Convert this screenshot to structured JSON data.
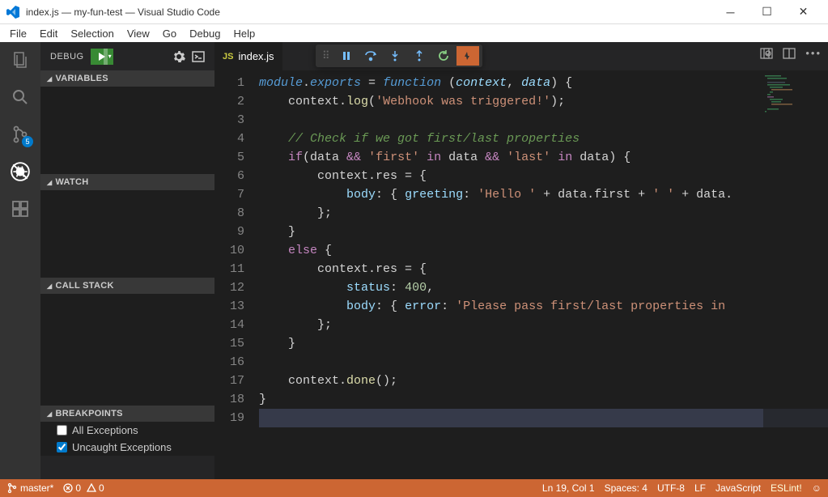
{
  "title": "index.js — my-fun-test — Visual Studio Code",
  "menu": [
    "File",
    "Edit",
    "Selection",
    "View",
    "Go",
    "Debug",
    "Help"
  ],
  "activity_badge": "5",
  "sidebar": {
    "header": "DEBUG",
    "sections": {
      "variables": "VARIABLES",
      "watch": "WATCH",
      "callstack": "CALL STACK",
      "breakpoints": "BREAKPOINTS"
    },
    "breakpoints": [
      {
        "label": "All Exceptions",
        "checked": false
      },
      {
        "label": "Uncaught Exceptions",
        "checked": true
      }
    ]
  },
  "tab": {
    "filename": "index.js",
    "lang_icon": "JS"
  },
  "code_lines": [
    {
      "n": 1,
      "segs": [
        {
          "c": "k1",
          "t": "module"
        },
        {
          "c": "p",
          "t": "."
        },
        {
          "c": "k1",
          "t": "exports"
        },
        {
          "c": "op",
          "t": " = "
        },
        {
          "c": "k1",
          "t": "function"
        },
        {
          "c": "op",
          "t": " ("
        },
        {
          "c": "v",
          "t": "context"
        },
        {
          "c": "op",
          "t": ", "
        },
        {
          "c": "v",
          "t": "data"
        },
        {
          "c": "op",
          "t": ") {"
        }
      ]
    },
    {
      "n": 2,
      "segs": [
        {
          "c": "op",
          "t": "    context."
        },
        {
          "c": "fn",
          "t": "log"
        },
        {
          "c": "op",
          "t": "("
        },
        {
          "c": "s",
          "t": "'Webhook was triggered!'"
        },
        {
          "c": "op",
          "t": ");"
        }
      ]
    },
    {
      "n": 3,
      "segs": []
    },
    {
      "n": 4,
      "segs": [
        {
          "c": "op",
          "t": "    "
        },
        {
          "c": "c",
          "t": "// Check if we got first/last properties"
        }
      ]
    },
    {
      "n": 5,
      "segs": [
        {
          "c": "op",
          "t": "    "
        },
        {
          "c": "k2",
          "t": "if"
        },
        {
          "c": "op",
          "t": "(data "
        },
        {
          "c": "amp",
          "t": "&&"
        },
        {
          "c": "op",
          "t": " "
        },
        {
          "c": "s",
          "t": "'first'"
        },
        {
          "c": "op",
          "t": " "
        },
        {
          "c": "k2",
          "t": "in"
        },
        {
          "c": "op",
          "t": " data "
        },
        {
          "c": "amp",
          "t": "&&"
        },
        {
          "c": "op",
          "t": " "
        },
        {
          "c": "s",
          "t": "'last'"
        },
        {
          "c": "op",
          "t": " "
        },
        {
          "c": "k2",
          "t": "in"
        },
        {
          "c": "op",
          "t": " data) {"
        }
      ]
    },
    {
      "n": 6,
      "segs": [
        {
          "c": "op",
          "t": "        context.res = {"
        }
      ]
    },
    {
      "n": 7,
      "segs": [
        {
          "c": "op",
          "t": "            "
        },
        {
          "c": "vn",
          "t": "body"
        },
        {
          "c": "op",
          "t": ": { "
        },
        {
          "c": "vn",
          "t": "greeting"
        },
        {
          "c": "op",
          "t": ": "
        },
        {
          "c": "s",
          "t": "'Hello '"
        },
        {
          "c": "op",
          "t": " + data.first + "
        },
        {
          "c": "s",
          "t": "' '"
        },
        {
          "c": "op",
          "t": " + data."
        }
      ]
    },
    {
      "n": 8,
      "segs": [
        {
          "c": "op",
          "t": "        };"
        }
      ]
    },
    {
      "n": 9,
      "segs": [
        {
          "c": "op",
          "t": "    }"
        }
      ]
    },
    {
      "n": 10,
      "segs": [
        {
          "c": "op",
          "t": "    "
        },
        {
          "c": "k2",
          "t": "else"
        },
        {
          "c": "op",
          "t": " {"
        }
      ]
    },
    {
      "n": 11,
      "segs": [
        {
          "c": "op",
          "t": "        context.res = {"
        }
      ]
    },
    {
      "n": 12,
      "segs": [
        {
          "c": "op",
          "t": "            "
        },
        {
          "c": "vn",
          "t": "status"
        },
        {
          "c": "op",
          "t": ": "
        },
        {
          "c": "n",
          "t": "400"
        },
        {
          "c": "op",
          "t": ","
        }
      ]
    },
    {
      "n": 13,
      "segs": [
        {
          "c": "op",
          "t": "            "
        },
        {
          "c": "vn",
          "t": "body"
        },
        {
          "c": "op",
          "t": ": { "
        },
        {
          "c": "vn",
          "t": "error"
        },
        {
          "c": "op",
          "t": ": "
        },
        {
          "c": "s",
          "t": "'Please pass first/last properties in"
        }
      ]
    },
    {
      "n": 14,
      "segs": [
        {
          "c": "op",
          "t": "        };"
        }
      ]
    },
    {
      "n": 15,
      "segs": [
        {
          "c": "op",
          "t": "    }"
        }
      ]
    },
    {
      "n": 16,
      "segs": []
    },
    {
      "n": 17,
      "segs": [
        {
          "c": "op",
          "t": "    context."
        },
        {
          "c": "fn",
          "t": "done"
        },
        {
          "c": "op",
          "t": "();"
        }
      ]
    },
    {
      "n": 18,
      "segs": [
        {
          "c": "op",
          "t": "}"
        }
      ]
    },
    {
      "n": 19,
      "segs": [],
      "cursor": true
    }
  ],
  "status": {
    "branch": "master*",
    "errors": "0",
    "warnings": "0",
    "position": "Ln 19, Col 1",
    "spaces": "Spaces: 4",
    "encoding": "UTF-8",
    "eol": "LF",
    "language": "JavaScript",
    "lint": "ESLint!"
  }
}
